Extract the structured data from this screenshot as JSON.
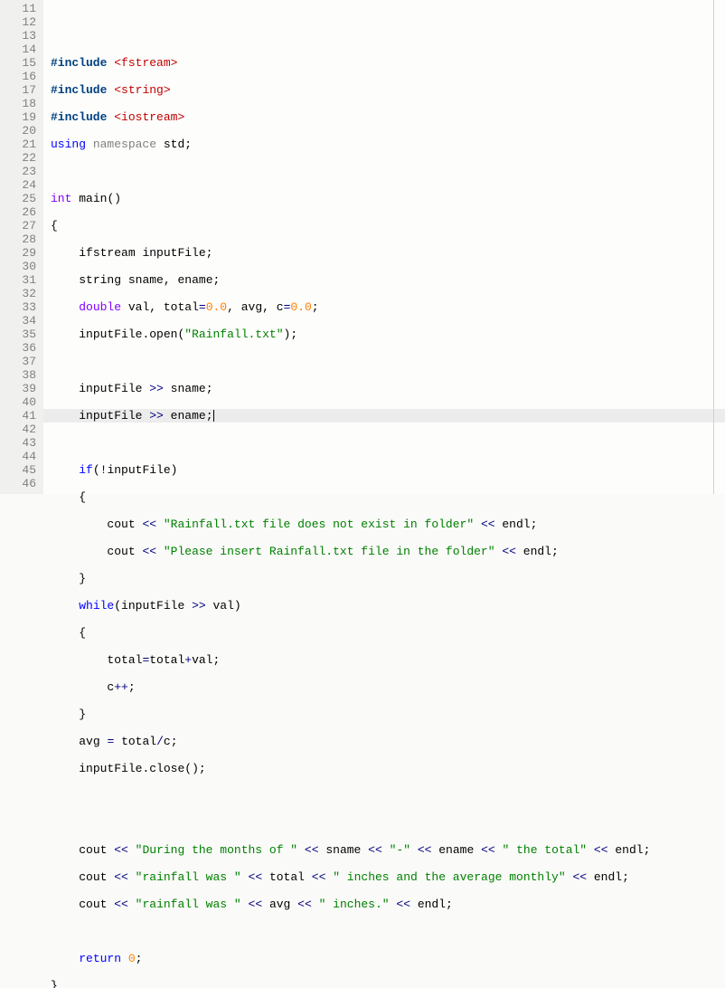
{
  "gutter": {
    "start": 11,
    "end": 46
  },
  "highlight_line": 25,
  "tokens": {
    "include": "#include",
    "inc_fstream": "<fstream>",
    "inc_string": "<string>",
    "inc_iostream": "<iostream>",
    "using": "using",
    "namespace": "namespace",
    "std": "std",
    "semi": ";",
    "int": "int",
    "main": "main",
    "lparen": "(",
    "rparen": ")",
    "lbrace": "{",
    "rbrace": "}",
    "ifstream": "ifstream",
    "inputFile": "inputFile",
    "string_t": "string",
    "sname": "sname",
    "comma": ",",
    "ename": "ename",
    "double": "double",
    "val": "val",
    "total": "total",
    "eq": "=",
    "zero": "0.0",
    "avg": "avg",
    "c": "c",
    "dot": ".",
    "open": "open",
    "rainfall_txt": "\"Rainfall.txt\"",
    "rshift": ">>",
    "if": "if",
    "not": "!",
    "cout": "cout",
    "lshift": "<<",
    "str_noexist": "\"Rainfall.txt file does not exist in folder\"",
    "endl": "endl",
    "str_please": "\"Please insert Rainfall.txt file in the folder\"",
    "while": "while",
    "plus": "+",
    "plusplus": "++",
    "slash": "/",
    "close": "close",
    "str_during": "\"During the months of \"",
    "str_dash": "\"-\"",
    "str_thetotal": "\" the total\"",
    "str_rainfallwas": "\"rainfall was \"",
    "str_inchesavg": "\" inches and the average monthly\"",
    "str_inches": "\" inches.\"",
    "return": "return",
    "zero_i": "0"
  }
}
